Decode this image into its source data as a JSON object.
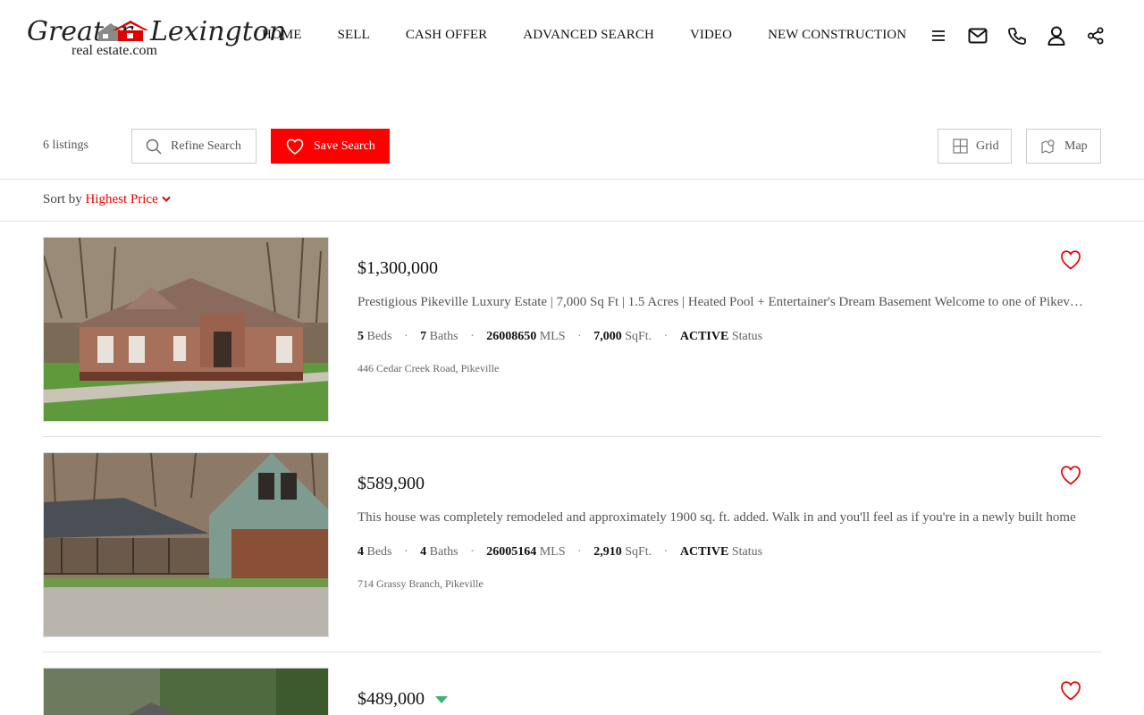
{
  "logo": {
    "word1": "Greater",
    "word2": "Lexington",
    "sub": "real estate.com"
  },
  "nav": [
    "HOME",
    "SELL",
    "CASH OFFER",
    "ADVANCED SEARCH",
    "VIDEO",
    "NEW CONSTRUCTION"
  ],
  "header_icons": [
    "menu-icon",
    "mail-icon",
    "phone-icon",
    "user-icon",
    "share-icon"
  ],
  "toolbar": {
    "count": "6 listings",
    "refine_label": "Refine Search",
    "save_label": "Save Search",
    "grid_label": "Grid",
    "map_label": "Map"
  },
  "sort": {
    "label": "Sort by",
    "value": "Highest Price"
  },
  "colors": {
    "accent": "#ff0000",
    "price_down": "#3cb371"
  },
  "listings": [
    {
      "price": "$1,300,000",
      "description": "Prestigious Pikeville Luxury Estate | 7,000 Sq Ft | 1.5 Acres | Heated Pool + Entertainer's Dream Basement Welcome to one of Pikeville's most prestigious estates",
      "beds": "5",
      "beds_label": "Beds",
      "baths": "7",
      "baths_label": "Baths",
      "mls": "26008650",
      "mls_label": "MLS",
      "sqft": "7,000",
      "sqft_label": "SqFt.",
      "status": "ACTIVE",
      "status_label": "Status",
      "address": "446 Cedar Creek Road, Pikeville"
    },
    {
      "price": "$589,900",
      "description": "This house was completely remodeled and approximately 1900 sq. ft. added. Walk in and you'll feel as if you're in a newly built home",
      "beds": "4",
      "beds_label": "Beds",
      "baths": "4",
      "baths_label": "Baths",
      "mls": "26005164",
      "mls_label": "MLS",
      "sqft": "2,910",
      "sqft_label": "SqFt.",
      "status": "ACTIVE",
      "status_label": "Status",
      "address": "714 Grassy Branch, Pikeville"
    },
    {
      "price": "$489,000",
      "price_reduced": true
    }
  ]
}
